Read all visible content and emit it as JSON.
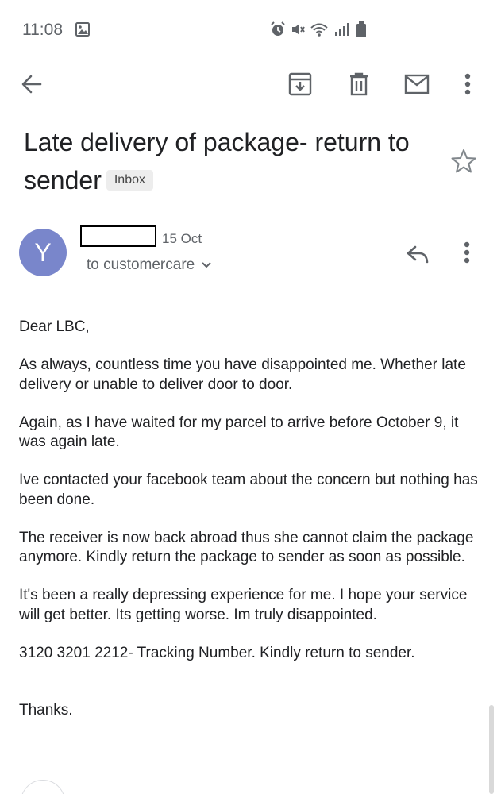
{
  "status_bar": {
    "time": "11:08"
  },
  "toolbar": {
    "back_icon": "arrow-left-icon",
    "archive_icon": "archive-icon",
    "delete_icon": "trash-icon",
    "mark_unread_icon": "mail-icon",
    "more_icon": "more-vert-icon"
  },
  "email": {
    "subject": "Late delivery of package- return to sender",
    "label": "Inbox",
    "sender_initial": "Y",
    "date": "15 Oct",
    "recipient": "to customercare",
    "body": [
      "Dear LBC,",
      "As always, countless time you have disappointed me. Whether late delivery or unable to deliver door to door.",
      "Again, as I have waited for my parcel to arrive before October 9, it was again late.",
      "Ive contacted your facebook team about the concern but nothing has been done.",
      "The receiver is now back abroad thus she cannot claim the package anymore. Kindly return the package to sender as soon as possible.",
      "It's been a really depressing experience for me. I hope your service will get better. Its getting worse. Im truly disappointed.",
      "3120 3201 2212- Tracking Number. Kindly return to sender.",
      "Thanks."
    ]
  },
  "colors": {
    "avatar": "#7986cb",
    "icon": "#5f6368",
    "text": "#202124"
  }
}
